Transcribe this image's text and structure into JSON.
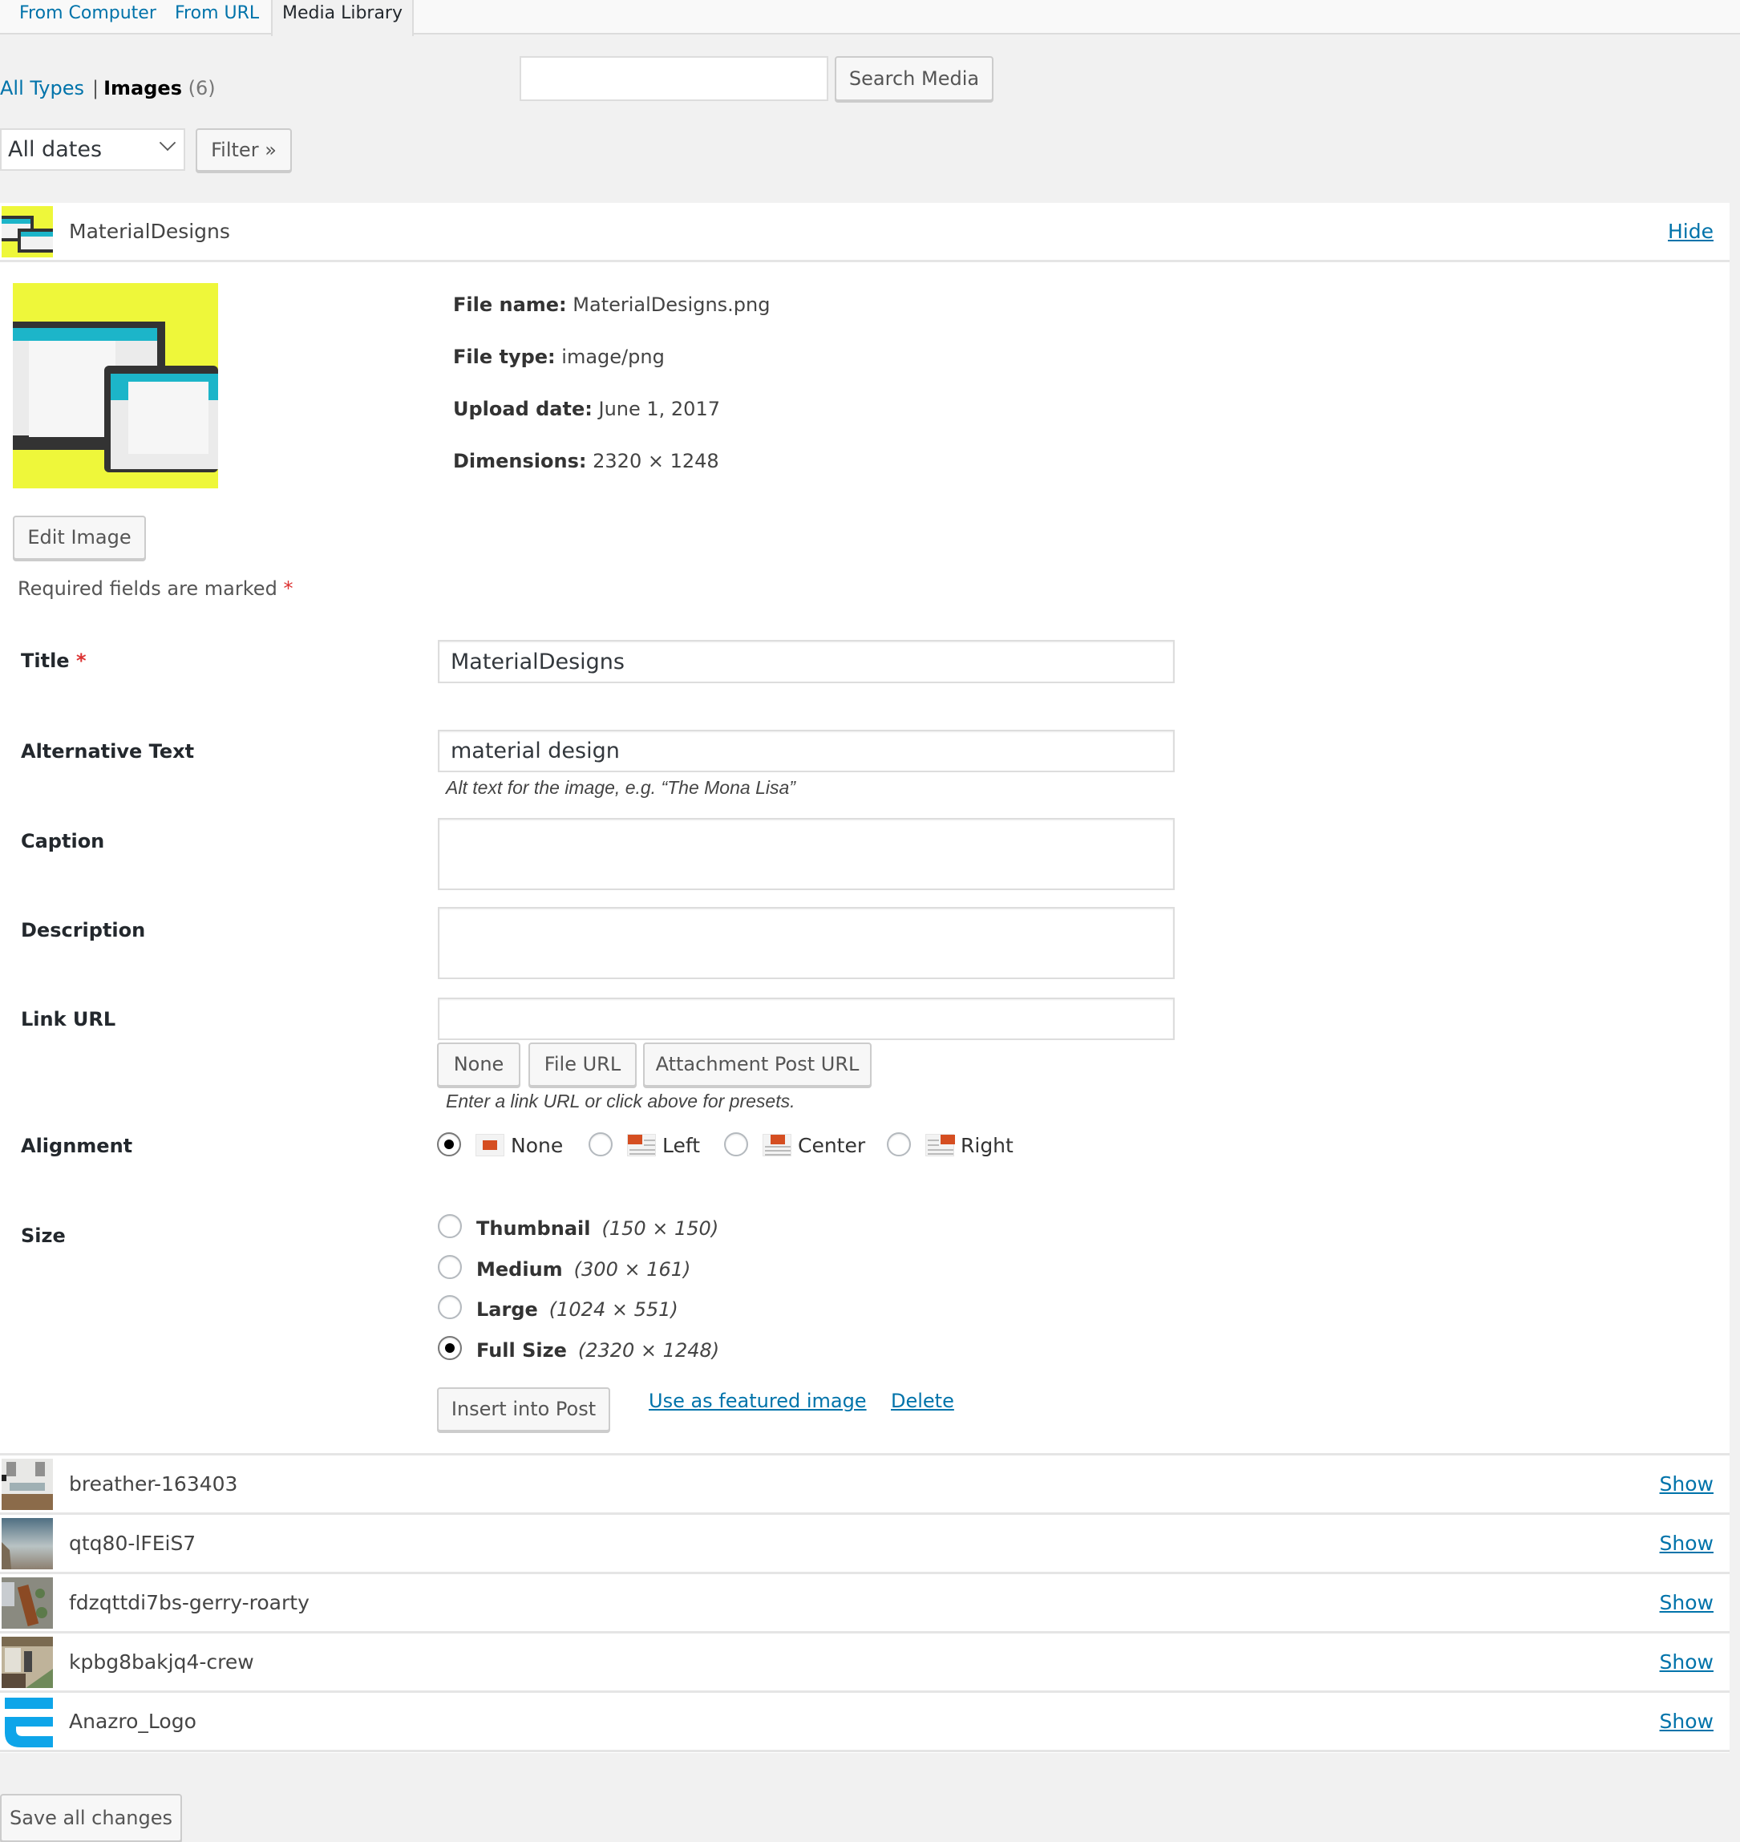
{
  "tabs": [
    {
      "label": "From Computer",
      "active": false
    },
    {
      "label": "From URL",
      "active": false
    },
    {
      "label": "Media Library",
      "active": true
    }
  ],
  "filters": {
    "all_types": "All Types",
    "images_label": "Images",
    "images_count": "(6)",
    "search_value": "",
    "search_button": "Search Media",
    "dates_selected": "All dates",
    "filter_button": "Filter »"
  },
  "expanded_item": {
    "title": "MaterialDesigns",
    "toggle_label": "Hide",
    "file_name_label": "File name:",
    "file_name": "MaterialDesigns.png",
    "file_type_label": "File type:",
    "file_type": "image/png",
    "upload_date_label": "Upload date:",
    "upload_date": "June 1, 2017",
    "dimensions_label": "Dimensions:",
    "dimensions": "2320 × 1248",
    "edit_image_button": "Edit Image",
    "required_note": "Required fields are marked",
    "required_star": "*",
    "fields": {
      "title_label": "Title",
      "title_value": "MaterialDesigns",
      "alt_label": "Alternative Text",
      "alt_value": "material design",
      "alt_hint": "Alt text for the image, e.g. “The Mona Lisa”",
      "caption_label": "Caption",
      "caption_value": "",
      "description_label": "Description",
      "description_value": "",
      "link_label": "Link URL",
      "link_value": "",
      "link_presets": [
        "None",
        "File URL",
        "Attachment Post URL"
      ],
      "link_hint": "Enter a link URL or click above for presets.",
      "alignment_label": "Alignment",
      "alignment_options": [
        {
          "label": "None",
          "checked": true
        },
        {
          "label": "Left",
          "checked": false
        },
        {
          "label": "Center",
          "checked": false
        },
        {
          "label": "Right",
          "checked": false
        }
      ],
      "size_label": "Size",
      "size_options": [
        {
          "label": "Thumbnail",
          "dims": "(150 × 150)",
          "checked": false
        },
        {
          "label": "Medium",
          "dims": "(300 × 161)",
          "checked": false
        },
        {
          "label": "Large",
          "dims": "(1024 × 551)",
          "checked": false
        },
        {
          "label": "Full Size",
          "dims": "(2320 × 1248)",
          "checked": true
        }
      ]
    },
    "insert_button": "Insert into Post",
    "featured_link": "Use as featured image",
    "delete_link": "Delete"
  },
  "collapsed_items": [
    {
      "title": "breather-163403",
      "toggle_label": "Show"
    },
    {
      "title": "qtq80-lFEiS7",
      "toggle_label": "Show"
    },
    {
      "title": "fdzqttdi7bs-gerry-roarty",
      "toggle_label": "Show"
    },
    {
      "title": "kpbg8bakjq4-crew",
      "toggle_label": "Show"
    },
    {
      "title": "Anazro_Logo",
      "toggle_label": "Show"
    }
  ],
  "save_all_button": "Save all changes"
}
